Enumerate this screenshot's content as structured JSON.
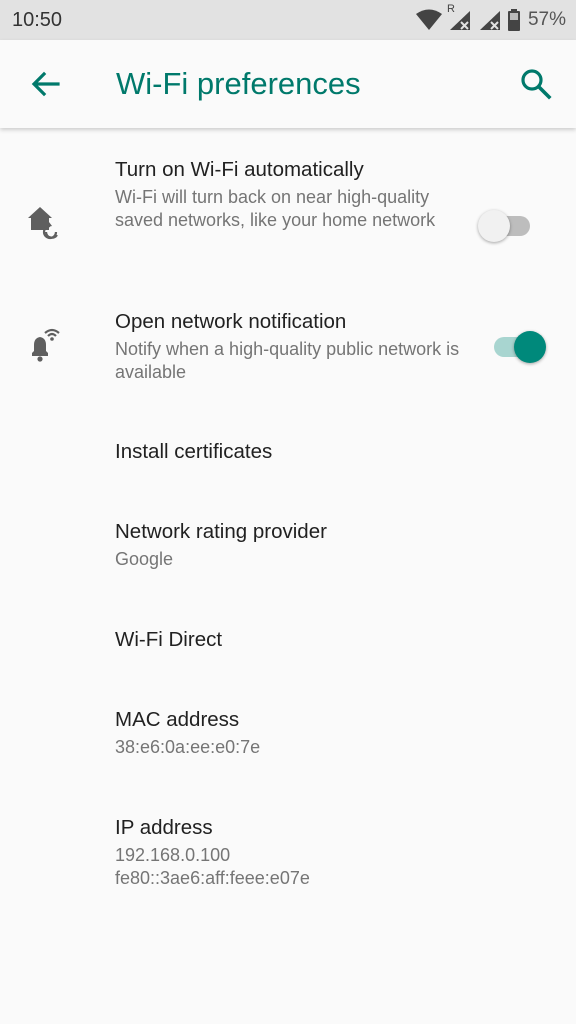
{
  "status_bar": {
    "time": "10:50",
    "battery": "57%",
    "roaming_indicator": "R",
    "icons": [
      "wifi-signal-icon",
      "cell-signal-icon",
      "cell-signal-icon",
      "battery-icon"
    ]
  },
  "app_bar": {
    "title": "Wi-Fi preferences",
    "back_icon": "arrow-back-icon",
    "search_icon": "search-icon"
  },
  "colors": {
    "accent": "#00796b",
    "switch_on": "#00897b",
    "status_bar_bg": "#e2e2e2",
    "background": "#fafafa"
  },
  "preferences": [
    {
      "title": "Turn on Wi-Fi automatically",
      "summary": "Wi-Fi will turn back on near high-quality saved networks, like your home network",
      "icon": "home-refresh-icon",
      "switch_on": false
    },
    {
      "title": "Open network notification",
      "summary": "Notify when a high-quality public network is available",
      "icon": "bell-wifi-icon",
      "switch_on": true
    },
    {
      "title": "Install certificates"
    },
    {
      "title": "Network rating provider",
      "summary": "Google"
    },
    {
      "title": "Wi-Fi Direct"
    },
    {
      "title": "MAC address",
      "summary": "38:e6:0a:ee:e0:7e"
    },
    {
      "title": "IP address",
      "summary_lines": [
        "192.168.0.100",
        "fe80::3ae6:aff:feee:e07e"
      ]
    }
  ]
}
